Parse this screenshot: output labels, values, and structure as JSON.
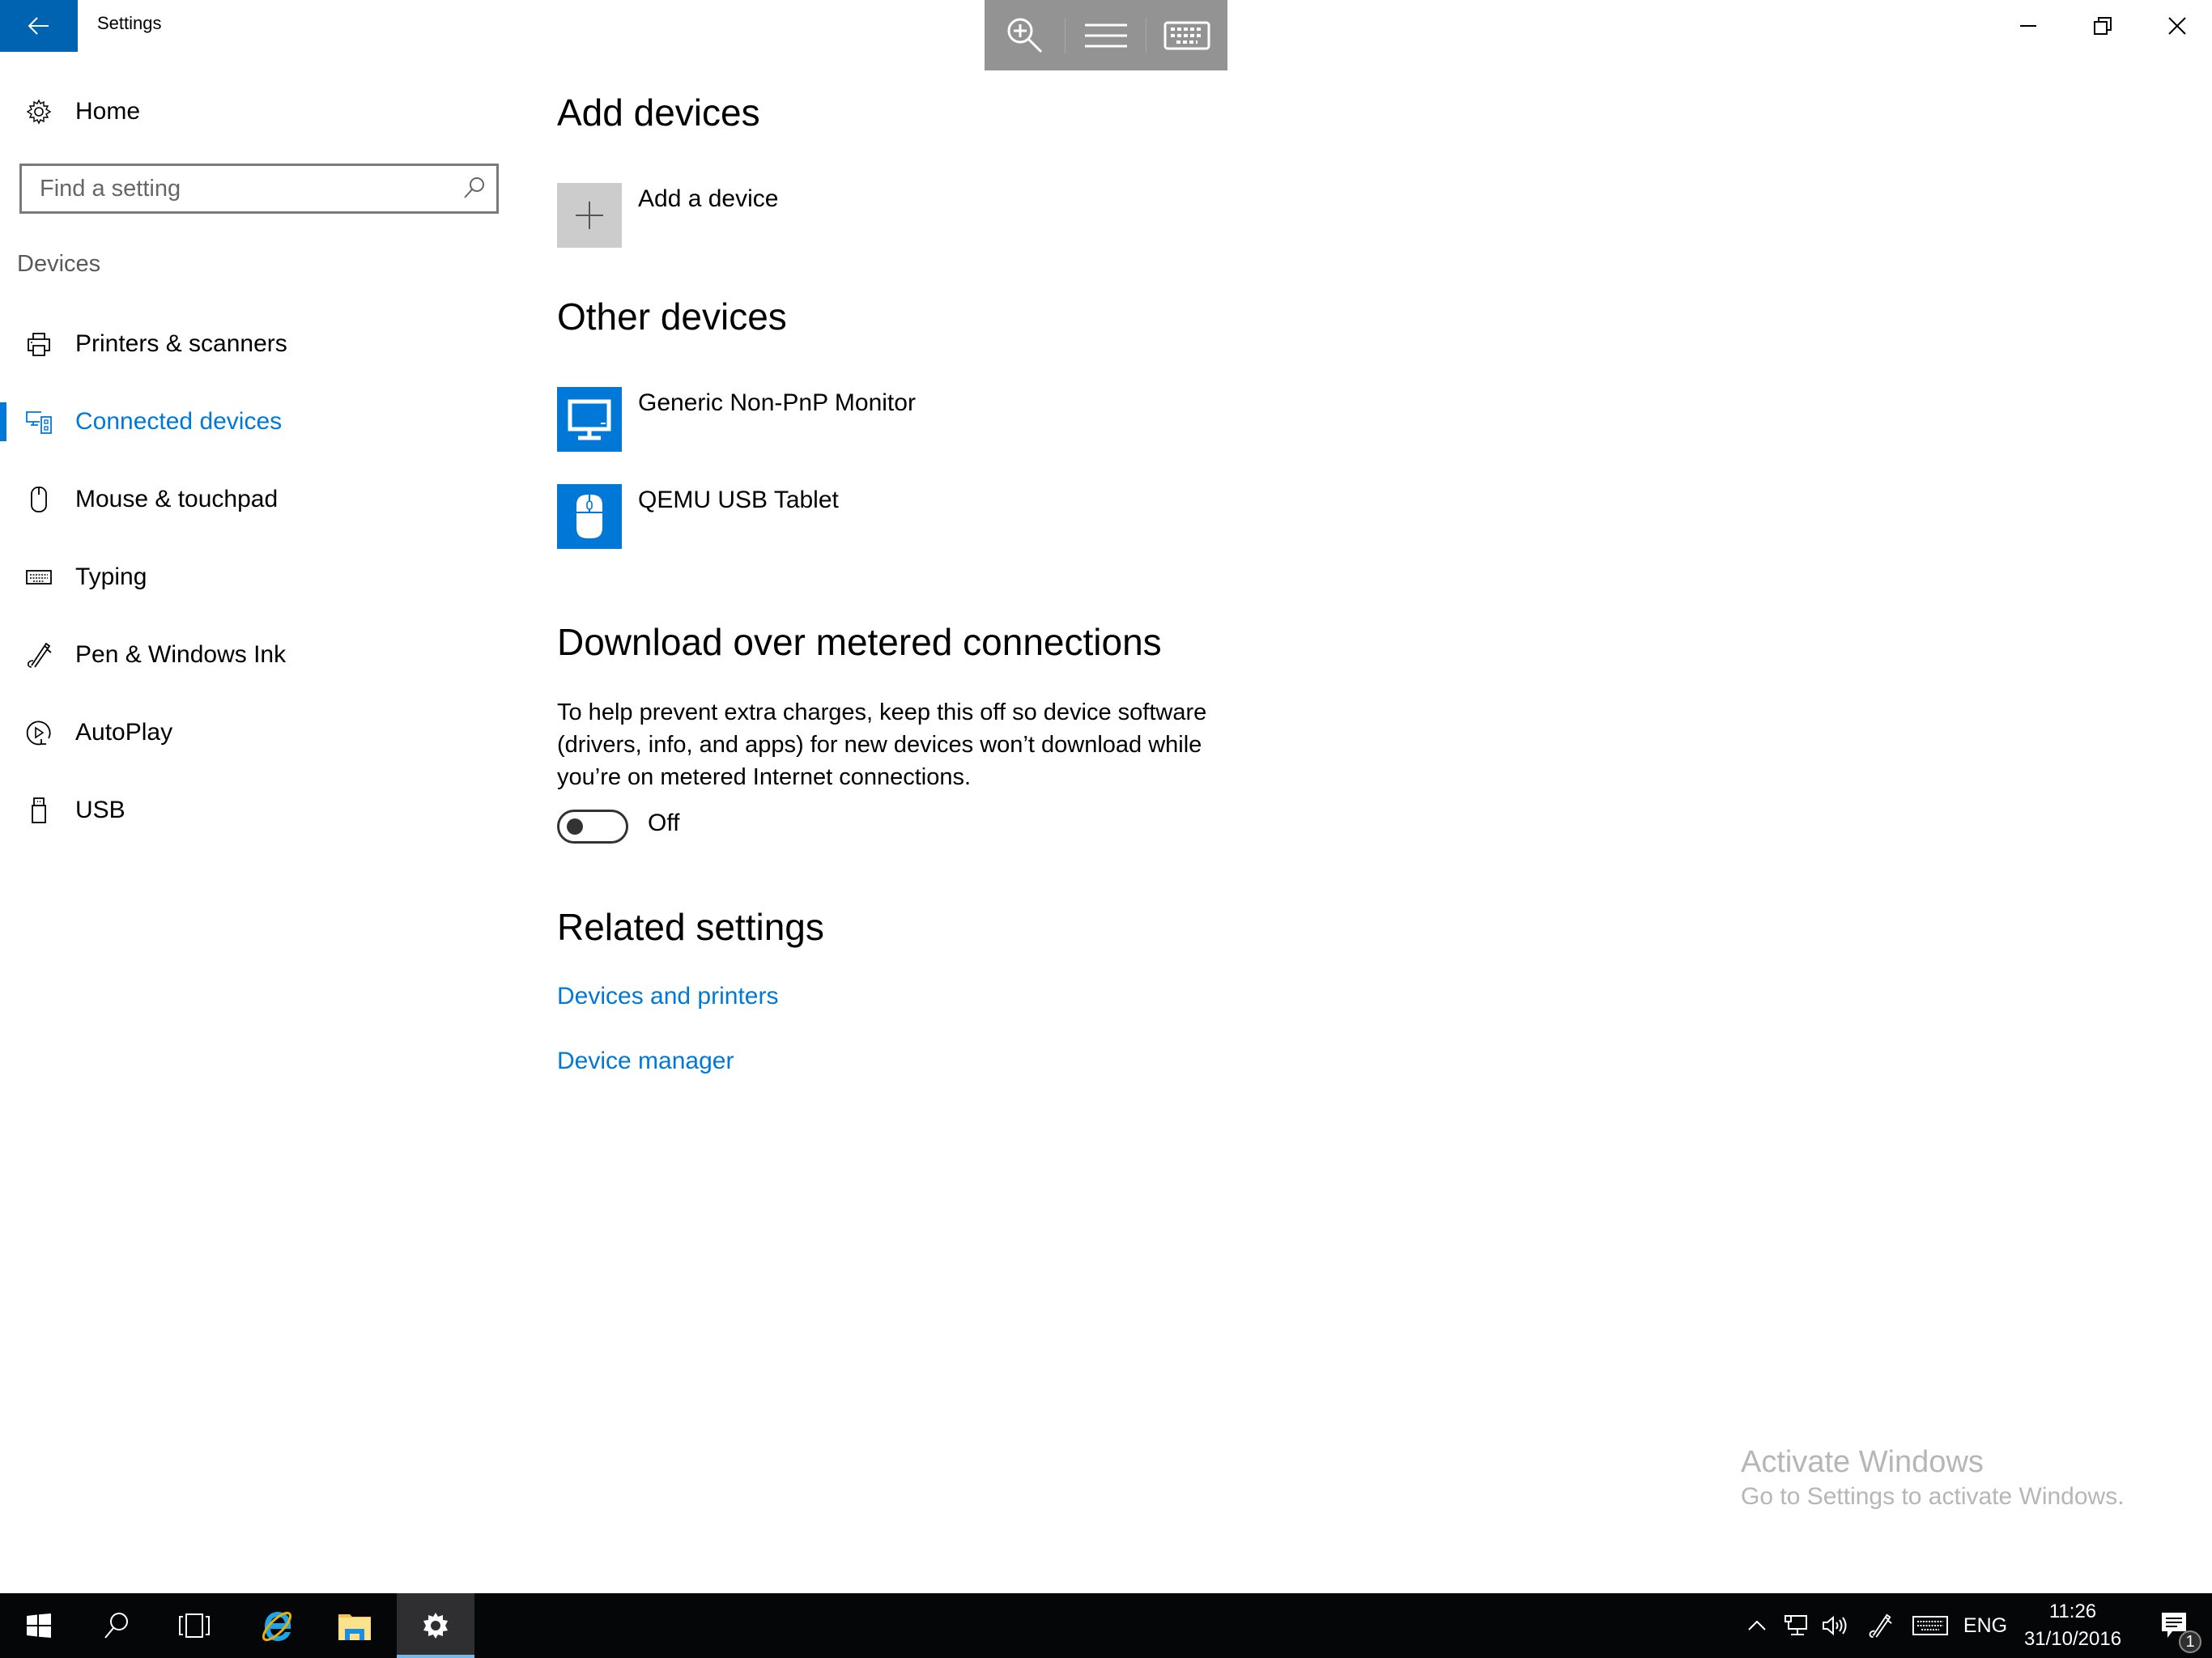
{
  "window": {
    "title": "Settings",
    "back_icon": "arrow-left-icon",
    "controls": {
      "minimize": "minimize-icon",
      "restore": "restore-icon",
      "close": "close-icon"
    }
  },
  "touch_toolbar": {
    "items": [
      "zoom-in-icon",
      "menu-icon",
      "keyboard-icon"
    ]
  },
  "sidebar": {
    "home_label": "Home",
    "search_placeholder": "Find a setting",
    "search_value": "",
    "section_label": "Devices",
    "items": [
      {
        "label": "Printers & scanners",
        "icon": "printer-icon",
        "active": false
      },
      {
        "label": "Connected devices",
        "icon": "connected-devices-icon",
        "active": true
      },
      {
        "label": "Mouse & touchpad",
        "icon": "mouse-icon",
        "active": false
      },
      {
        "label": "Typing",
        "icon": "keyboard-icon",
        "active": false
      },
      {
        "label": "Pen & Windows Ink",
        "icon": "pen-icon",
        "active": false
      },
      {
        "label": "AutoPlay",
        "icon": "autoplay-icon",
        "active": false
      },
      {
        "label": "USB",
        "icon": "usb-icon",
        "active": false
      }
    ]
  },
  "main": {
    "add_devices": {
      "heading": "Add devices",
      "button_label": "Add a device"
    },
    "other_devices": {
      "heading": "Other devices",
      "items": [
        {
          "label": "Generic Non-PnP Monitor",
          "icon": "monitor-icon"
        },
        {
          "label": "QEMU USB Tablet",
          "icon": "mouse-icon"
        }
      ]
    },
    "metered": {
      "heading": "Download over metered connections",
      "description": "To help prevent extra charges, keep this off so device software (drivers, info, and apps) for new devices won’t download while you’re on metered Internet connections.",
      "toggle_on": false,
      "toggle_label": "Off"
    },
    "related": {
      "heading": "Related settings",
      "links": [
        "Devices and printers",
        "Device manager"
      ]
    }
  },
  "watermark": {
    "title": "Activate Windows",
    "subtitle": "Go to Settings to activate Windows."
  },
  "taskbar": {
    "apps": [
      "start-icon",
      "search-icon",
      "task-view-icon",
      "internet-explorer-icon",
      "file-explorer-icon",
      "settings-icon"
    ],
    "tray": {
      "language": "ENG",
      "time": "11:26",
      "date": "31/10/2016",
      "notification_count": "1"
    }
  },
  "colors": {
    "accent": "#0078D7",
    "back_button": "#0063B1",
    "toolbar": "#939393",
    "taskbar": "#050608"
  }
}
